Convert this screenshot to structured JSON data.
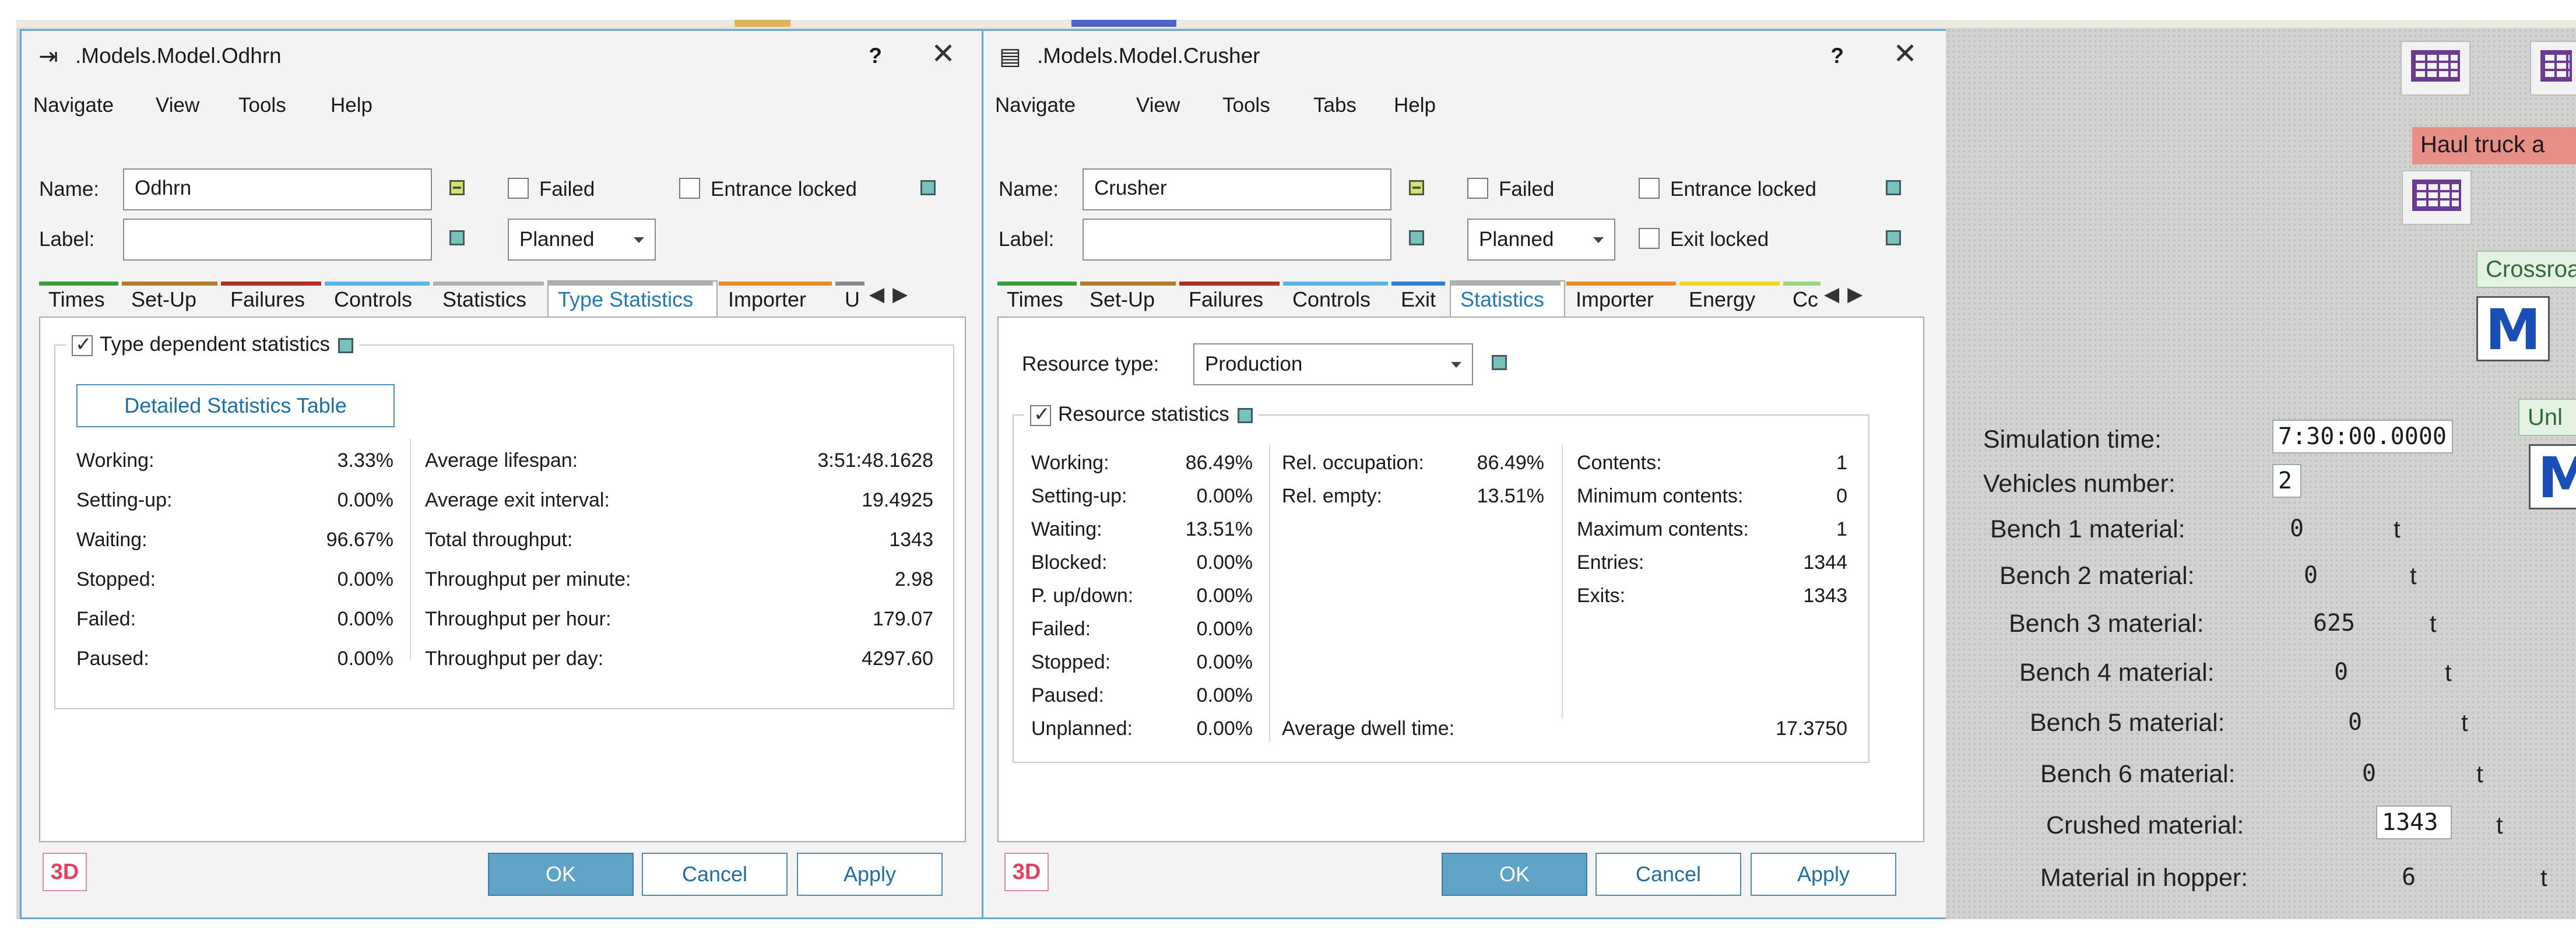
{
  "dialogs": [
    {
      "title": ".Models.Model.Odhrn",
      "help": "?",
      "close": "✕",
      "menu": [
        "Navigate",
        "View",
        "Tools",
        "Help"
      ],
      "name_label": "Name:",
      "name_value": "Odhrn",
      "label_label": "Label:",
      "label_value": "",
      "failed": "Failed",
      "entrance_locked": "Entrance locked",
      "planned": "Planned",
      "tabs": [
        {
          "label": "Times",
          "color": "#3b9c3b"
        },
        {
          "label": "Set-Up",
          "color": "#b57a2c"
        },
        {
          "label": "Failures",
          "color": "#b22a2a"
        },
        {
          "label": "Controls",
          "color": "#58b7e4"
        },
        {
          "label": "Statistics",
          "color": "#b0b0b0"
        },
        {
          "label": "Type Statistics",
          "color": "#b0b0b0"
        },
        {
          "label": "Importer",
          "color": "#ee8a24"
        },
        {
          "label": "U",
          "color": "#8a8a8a"
        }
      ],
      "active_tab": "Type Statistics",
      "group_title": "Type dependent statistics",
      "detail_button": "Detailed Statistics Table",
      "left_stats": [
        {
          "label": "Working:",
          "value": "3.33%"
        },
        {
          "label": "Setting-up:",
          "value": "0.00%"
        },
        {
          "label": "Waiting:",
          "value": "96.67%"
        },
        {
          "label": "Stopped:",
          "value": "0.00%"
        },
        {
          "label": "Failed:",
          "value": "0.00%"
        },
        {
          "label": "Paused:",
          "value": "0.00%"
        }
      ],
      "right_stats": [
        {
          "label": "Average lifespan:",
          "value": "3:51:48.1628"
        },
        {
          "label": "Average exit interval:",
          "value": "19.4925"
        },
        {
          "label": "Total throughput:",
          "value": "1343"
        },
        {
          "label": "Throughput per minute:",
          "value": "2.98"
        },
        {
          "label": "Throughput per hour:",
          "value": "179.07"
        },
        {
          "label": "Throughput per day:",
          "value": "4297.60"
        }
      ],
      "badge": "3D",
      "ok": "OK",
      "cancel": "Cancel",
      "apply": "Apply"
    },
    {
      "title": ".Models.Model.Crusher",
      "help": "?",
      "close": "✕",
      "menu": [
        "Navigate",
        "View",
        "Tools",
        "Tabs",
        "Help"
      ],
      "name_label": "Name:",
      "name_value": "Crusher",
      "label_label": "Label:",
      "label_value": "",
      "failed": "Failed",
      "entrance_locked": "Entrance locked",
      "exit_locked": "Exit locked",
      "planned": "Planned",
      "tabs": [
        {
          "label": "Times",
          "color": "#3b9c3b"
        },
        {
          "label": "Set-Up",
          "color": "#b57a2c"
        },
        {
          "label": "Failures",
          "color": "#b22a2a"
        },
        {
          "label": "Controls",
          "color": "#58b7e4"
        },
        {
          "label": "Exit",
          "color": "#2f7fd8"
        },
        {
          "label": "Statistics",
          "color": "#b0b0b0"
        },
        {
          "label": "Importer",
          "color": "#ee8a24"
        },
        {
          "label": "Energy",
          "color": "#eadb1e"
        },
        {
          "label": "Cc",
          "color": "#9fd67d"
        }
      ],
      "active_tab": "Statistics",
      "resource_type_label": "Resource type:",
      "resource_type_value": "Production",
      "group_title": "Resource statistics",
      "col1": [
        {
          "label": "Working:",
          "value": "86.49%"
        },
        {
          "label": "Setting-up:",
          "value": "0.00%"
        },
        {
          "label": "Waiting:",
          "value": "13.51%"
        },
        {
          "label": "Blocked:",
          "value": "0.00%"
        },
        {
          "label": "P. up/down:",
          "value": "0.00%"
        },
        {
          "label": "Failed:",
          "value": "0.00%"
        },
        {
          "label": "Stopped:",
          "value": "0.00%"
        },
        {
          "label": "Paused:",
          "value": "0.00%"
        },
        {
          "label": "Unplanned:",
          "value": "0.00%"
        }
      ],
      "col2": [
        {
          "label": "Rel. occupation:",
          "value": "86.49%"
        },
        {
          "label": "Rel. empty:",
          "value": "13.51%"
        }
      ],
      "col3": [
        {
          "label": "Contents:",
          "value": "1"
        },
        {
          "label": "Minimum contents:",
          "value": "0"
        },
        {
          "label": "Maximum contents:",
          "value": "1"
        },
        {
          "label": "Entries:",
          "value": "1344"
        },
        {
          "label": "Exits:",
          "value": "1343"
        }
      ],
      "dwell_label": "Average dwell time:",
      "dwell_value": "17.3750",
      "badge": "3D",
      "ok": "OK",
      "cancel": "Cancel",
      "apply": "Apply"
    }
  ],
  "viewport": {
    "banners": {
      "haul": "Haul truck a",
      "crossroad": "Crossroa",
      "unl": "Unl"
    },
    "m_icon": "M",
    "rows": [
      {
        "label": "Simulation time:",
        "value": "7:30:00.0000",
        "unit": ""
      },
      {
        "label": "Vehicles number:",
        "value": "2",
        "unit": ""
      },
      {
        "label": "Bench 1 material:",
        "value": "0",
        "unit": "t"
      },
      {
        "label": "Bench 2 material:",
        "value": "0",
        "unit": "t"
      },
      {
        "label": "Bench 3 material:",
        "value": "625",
        "unit": "t"
      },
      {
        "label": "Bench 4 material:",
        "value": "0",
        "unit": "t"
      },
      {
        "label": "Bench 5 material:",
        "value": "0",
        "unit": "t"
      },
      {
        "label": "Bench 6 material:",
        "value": "0",
        "unit": "t"
      },
      {
        "label": "Crushed material:",
        "value": "1343",
        "unit": "t"
      },
      {
        "label": "Material in hopper:",
        "value": "6",
        "unit": "t"
      }
    ]
  }
}
